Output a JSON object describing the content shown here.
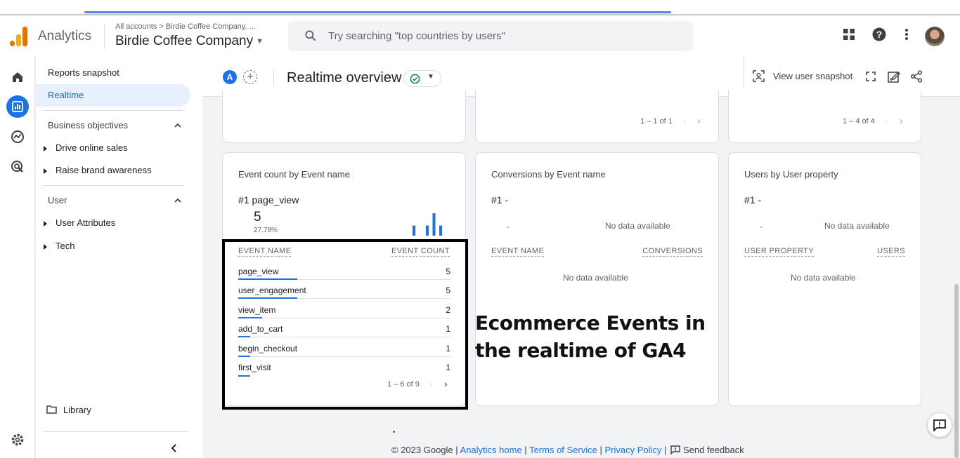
{
  "topbar": {
    "app_name": "Analytics",
    "breadcrumb": "All accounts > Birdie Coffee Company, ...",
    "property": "Birdie Coffee Company",
    "search_placeholder": "Try searching \"top countries by users\""
  },
  "sidenav": {
    "reports_snapshot": "Reports snapshot",
    "realtime": "Realtime",
    "business_objectives": "Business objectives",
    "drive_online_sales": "Drive online sales",
    "raise_brand_awareness": "Raise brand awareness",
    "user": "User",
    "user_attributes": "User Attributes",
    "tech": "Tech",
    "library": "Library"
  },
  "header": {
    "comparison_badge": "A",
    "add_comparison": "+",
    "title": "Realtime overview",
    "view_user_snapshot": "View user snapshot"
  },
  "top_cards": {
    "middle_pager": "1 – 1 of 1",
    "right_pager": "1 – 4 of 4"
  },
  "event_card": {
    "title": "Event count by Event name",
    "rank_label": "#1",
    "top_event": "page_view",
    "top_value": "5",
    "top_percent": "27.78%",
    "sparkline": [
      0.45,
      0,
      0.45,
      1,
      0.45
    ],
    "col_name": "EVENT NAME",
    "col_count": "EVENT COUNT",
    "rows": [
      {
        "name": "page_view",
        "count": "5",
        "share": 1.0
      },
      {
        "name": "user_engagement",
        "count": "5",
        "share": 1.0
      },
      {
        "name": "view_item",
        "count": "2",
        "share": 0.4
      },
      {
        "name": "add_to_cart",
        "count": "1",
        "share": 0.2
      },
      {
        "name": "begin_checkout",
        "count": "1",
        "share": 0.2
      },
      {
        "name": "first_visit",
        "count": "1",
        "share": 0.2
      }
    ],
    "pager": "1 – 6 of 9"
  },
  "conversions_card": {
    "title": "Conversions by Event name",
    "rank": "#1  -",
    "dash": "-",
    "no_data_top": "No data available",
    "col_name": "EVENT NAME",
    "col_value": "CONVERSIONS",
    "no_data_table": "No data available"
  },
  "users_card": {
    "title": "Users by User property",
    "rank": "#1  -",
    "dash": "-",
    "no_data_top": "No data available",
    "col_name": "USER PROPERTY",
    "col_value": "USERS",
    "no_data_table": "No data available"
  },
  "annotation": "Ecommerce Events in the realtime of GA4",
  "footer": {
    "copyright": "© 2023 Google | ",
    "analytics_home": "Analytics home",
    "sep1": " | ",
    "terms": "Terms of Service",
    "sep2": " | ",
    "privacy": "Privacy Policy",
    "sep3": " | ",
    "send_feedback": "Send feedback"
  },
  "colors": {
    "accent": "#1a73e8",
    "logo_orange": "#f9ab00",
    "logo_dark_orange": "#e37400",
    "success": "#188038"
  }
}
